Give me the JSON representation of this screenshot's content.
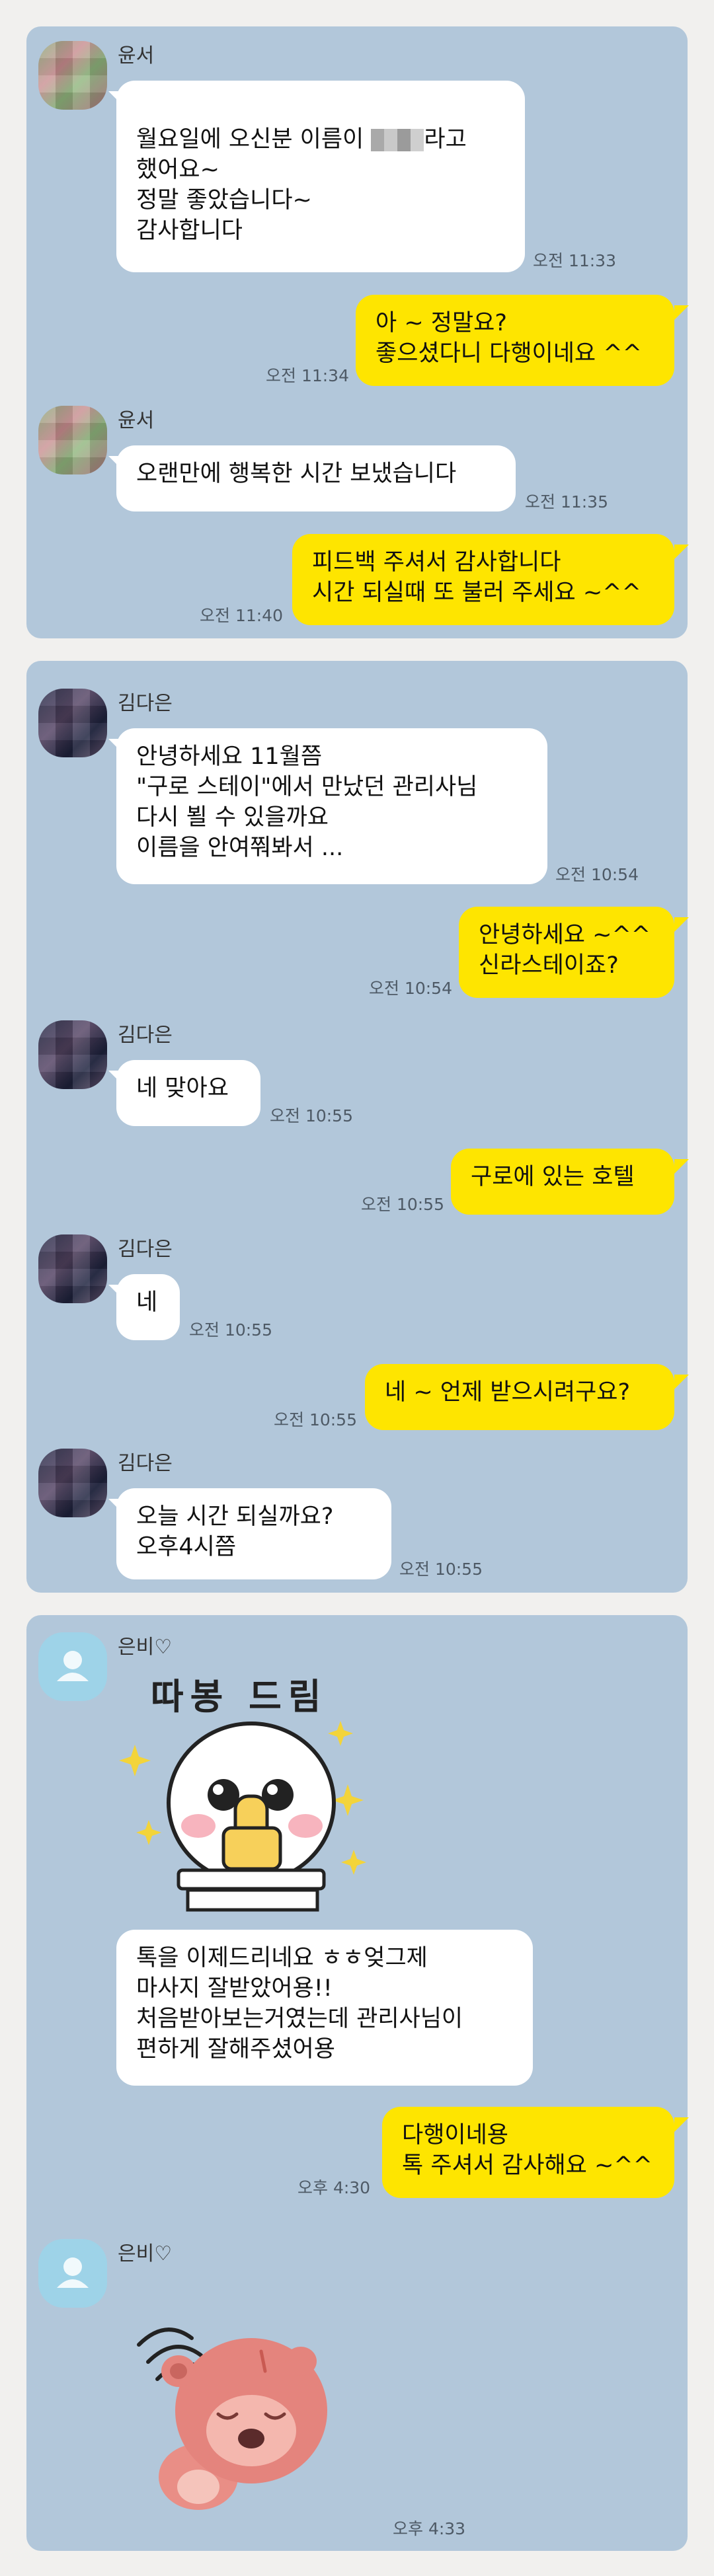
{
  "chats": [
    {
      "panel_id": "panel-1",
      "messages": [
        {
          "type": "in",
          "sender": "윤서",
          "text": "월요일에 오신분 이름이 ",
          "text_after": "라고\n했어요~\n정말 좋았습니다~\n감사합니다",
          "time": "오전 11:33"
        },
        {
          "type": "out",
          "text": "아 ~ 정말요?\n좋으셨다니 다행이네요 ^^",
          "time": "오전 11:34"
        },
        {
          "type": "in",
          "sender": "윤서",
          "text": "오랜만에 행복한 시간 보냈습니다",
          "time": "오전 11:35"
        },
        {
          "type": "out",
          "text": "피드백 주셔서 감사합니다\n시간 되실때 또 불러 주세요 ~^^",
          "time": "오전 11:40"
        }
      ]
    },
    {
      "panel_id": "panel-2",
      "messages": [
        {
          "type": "in",
          "sender": "김다은",
          "text": "안녕하세요 11월쯤\n\"구로 스테이\"에서 만났던 관리사님\n다시 뵐 수 있을까요\n이름을 안여쭤봐서 ...",
          "time": "오전 10:54"
        },
        {
          "type": "out",
          "text": "안녕하세요 ~^^\n신라스테이죠?",
          "time": "오전 10:54"
        },
        {
          "type": "in",
          "sender": "김다은",
          "text": "네 맞아요",
          "time": "오전 10:55"
        },
        {
          "type": "out",
          "text": "구로에 있는 호텔",
          "time": "오전 10:55"
        },
        {
          "type": "in",
          "sender": "김다은",
          "text": "네",
          "time": "오전 10:55"
        },
        {
          "type": "out",
          "text": "네 ~ 언제 받으시려구요?",
          "time": "오전 10:55"
        },
        {
          "type": "in",
          "sender": "김다은",
          "text": "오늘  시간 되실까요?\n오후4시쯤",
          "time": "오전 10:55"
        }
      ]
    },
    {
      "panel_id": "panel-3",
      "messages": [
        {
          "type": "in-sticker",
          "sender": "은비♡",
          "sticker_text": "따봉 드림",
          "sticker": "thumbs-up-sticker"
        },
        {
          "type": "in",
          "text": "톡을 이제드리네요 ㅎㅎ엊그제\n마사지 잘받았어용!!\n처음받아보는거였는데 관리사님이\n편하게 잘해주셨어용"
        },
        {
          "type": "out",
          "text": "다행이네용\n톡 주셔서 감사해요 ~^^",
          "time": "오후 4:30"
        },
        {
          "type": "in-sticker",
          "sender": "은비♡",
          "sticker": "beaver-sticker",
          "time": "오후 4:33"
        }
      ]
    }
  ],
  "colors": {
    "panel_bg": "#b2c7da",
    "bubble_in": "#ffffff",
    "bubble_out": "#fee500",
    "page_bg": "#f1f0ee"
  }
}
